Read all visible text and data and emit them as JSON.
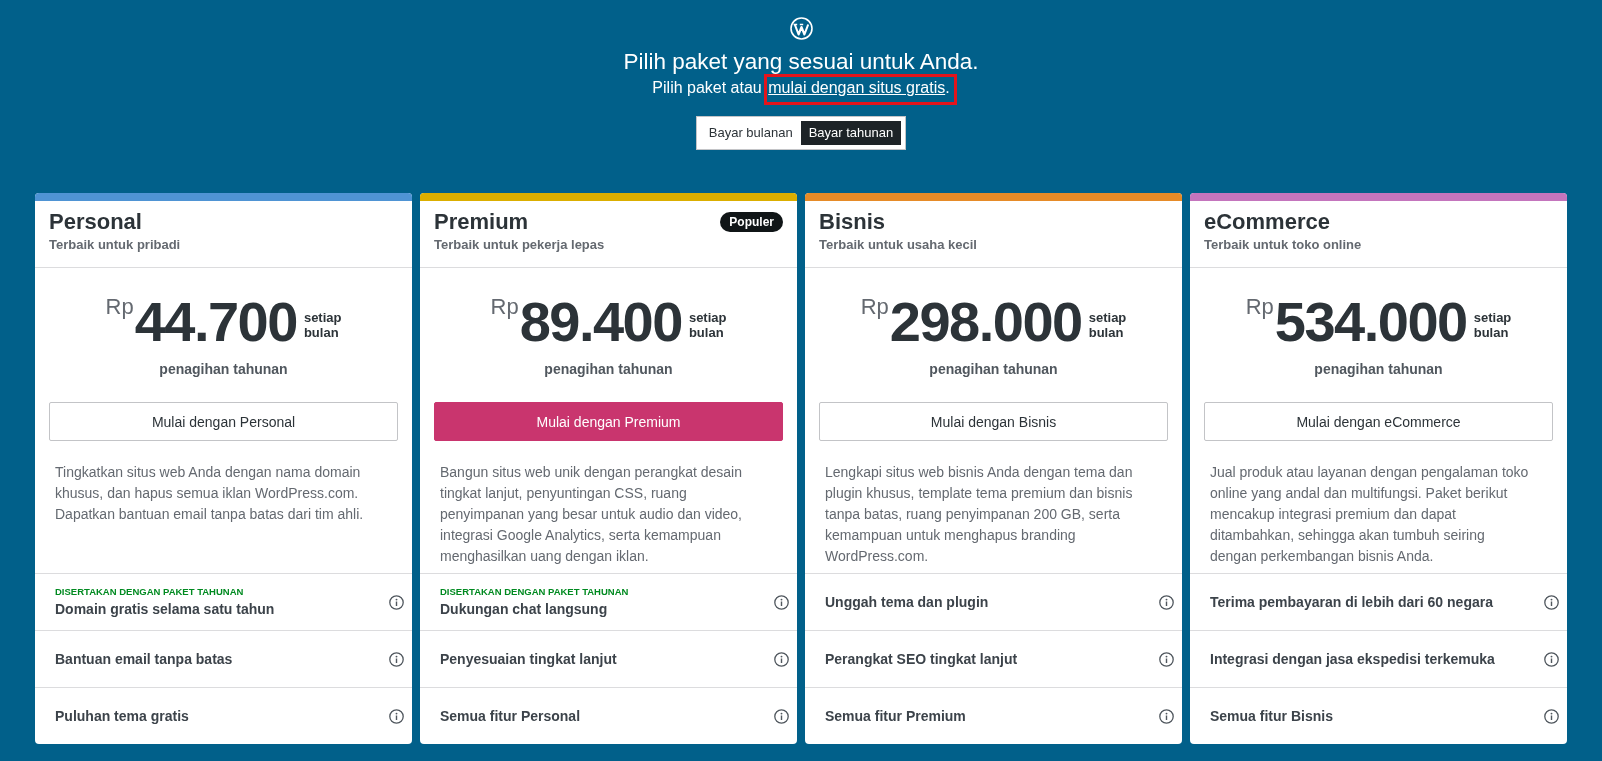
{
  "header": {
    "title": "Pilih paket yang sesuai untuk Anda.",
    "subtitle": "Pilih paket atau",
    "link": {
      "label": "mulai dengan situs gratis",
      "highlighted": true
    },
    "subtitle_end": "."
  },
  "billing_toggle": [
    {
      "label": "Bayar bulanan",
      "selected": false
    },
    {
      "label": "Bayar tahunan",
      "selected": true
    }
  ],
  "plans": [
    {
      "name": "Personal",
      "tagline": "Terbaik untuk pribadi",
      "color": "#4f94d4",
      "currency": "Rp",
      "price": "44.700",
      "period": "setiap bulan",
      "billing": "penagihan tahunan",
      "button": {
        "label": "Mulai dengan Personal",
        "primary": false
      },
      "description": "Tingkatkan situs web Anda dengan nama domain khusus, dan hapus semua iklan WordPress.com. Dapatkan bantuan email tanpa batas dari tim ahli.",
      "features": [
        {
          "tag": "DISERTAKAN DENGAN PAKET TAHUNAN",
          "label": "Domain gratis selama satu tahun"
        },
        {
          "label": "Bantuan email tanpa batas"
        },
        {
          "label": "Puluhan tema gratis"
        }
      ]
    },
    {
      "name": "Premium",
      "tagline": "Terbaik untuk pekerja lepas",
      "color": "#dbae00",
      "badge": "Populer",
      "currency": "Rp",
      "price": "89.400",
      "period": "setiap bulan",
      "billing": "penagihan tahunan",
      "button": {
        "label": "Mulai dengan Premium",
        "primary": true
      },
      "description": "Bangun situs web unik dengan perangkat desain tingkat lanjut, penyuntingan CSS, ruang penyimpanan yang besar untuk audio dan video, integrasi Google Analytics, serta kemampuan menghasilkan uang dengan iklan.",
      "features": [
        {
          "tag": "DISERTAKAN DENGAN PAKET TAHUNAN",
          "label": "Dukungan chat langsung"
        },
        {
          "label": "Penyesuaian tingkat lanjut"
        },
        {
          "label": "Semua fitur Personal"
        }
      ]
    },
    {
      "name": "Bisnis",
      "tagline": "Terbaik untuk usaha kecil",
      "color": "#e68b28",
      "currency": "Rp",
      "price": "298.000",
      "period": "setiap bulan",
      "billing": "penagihan tahunan",
      "button": {
        "label": "Mulai dengan Bisnis",
        "primary": false
      },
      "description": "Lengkapi situs web bisnis Anda dengan tema dan plugin khusus, template tema premium dan bisnis tanpa batas, ruang penyimpanan 200 GB, serta kemampuan untuk menghapus branding WordPress.com.",
      "features": [
        {
          "label": "Unggah tema dan plugin"
        },
        {
          "label": "Perangkat SEO tingkat lanjut"
        },
        {
          "label": "Semua fitur Premium"
        }
      ]
    },
    {
      "name": "eCommerce",
      "tagline": "Terbaik untuk toko online",
      "color": "#c475bd",
      "currency": "Rp",
      "price": "534.000",
      "period": "setiap bulan",
      "billing": "penagihan tahunan",
      "button": {
        "label": "Mulai dengan eCommerce",
        "primary": false
      },
      "description": "Jual produk atau layanan dengan pengalaman toko online yang andal dan multifungsi. Paket berikut mencakup integrasi premium dan dapat ditambahkan, sehingga akan tumbuh seiring dengan perkembangan bisnis Anda.",
      "features": [
        {
          "label": "Terima pembayaran di lebih dari 60 negara"
        },
        {
          "label": "Integrasi dengan jasa ekspedisi terkemuka"
        },
        {
          "label": "Semua fitur Bisnis"
        }
      ]
    }
  ]
}
